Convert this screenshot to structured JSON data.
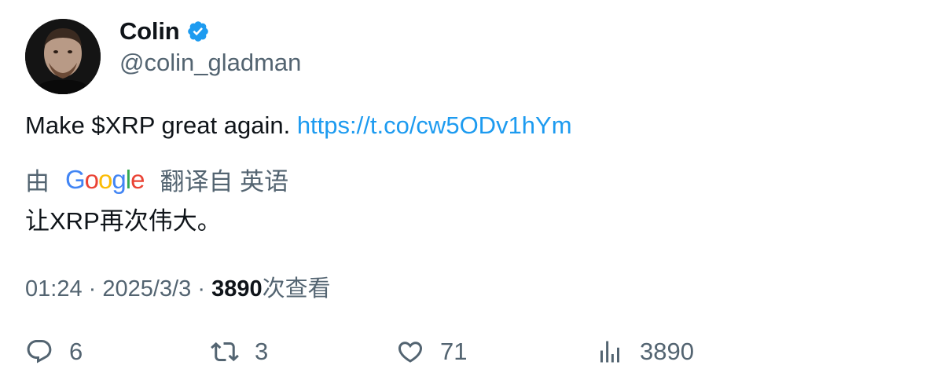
{
  "user": {
    "name": "Colin",
    "handle": "@colin_gladman",
    "verified_icon": "verified-badge-icon",
    "verified_color": "#1d9bf0"
  },
  "tweet": {
    "text": "Make $XRP great again.",
    "link": "https://t.co/cw5ODv1hYm",
    "link_color": "#1d9bf0"
  },
  "translation": {
    "prefix": "由",
    "provider": "Google",
    "suffix": "翻译自 英语",
    "text": "让XRP再次伟大。"
  },
  "meta": {
    "time": "01:24",
    "separator": "·",
    "date": "2025/3/3",
    "views": "3890",
    "views_label": "次查看"
  },
  "actions": {
    "reply": {
      "icon": "reply-icon",
      "count": "6"
    },
    "retweet": {
      "icon": "retweet-icon",
      "count": "3"
    },
    "like": {
      "icon": "heart-icon",
      "count": "71"
    },
    "views": {
      "icon": "bar-chart-icon",
      "count": "3890"
    }
  }
}
